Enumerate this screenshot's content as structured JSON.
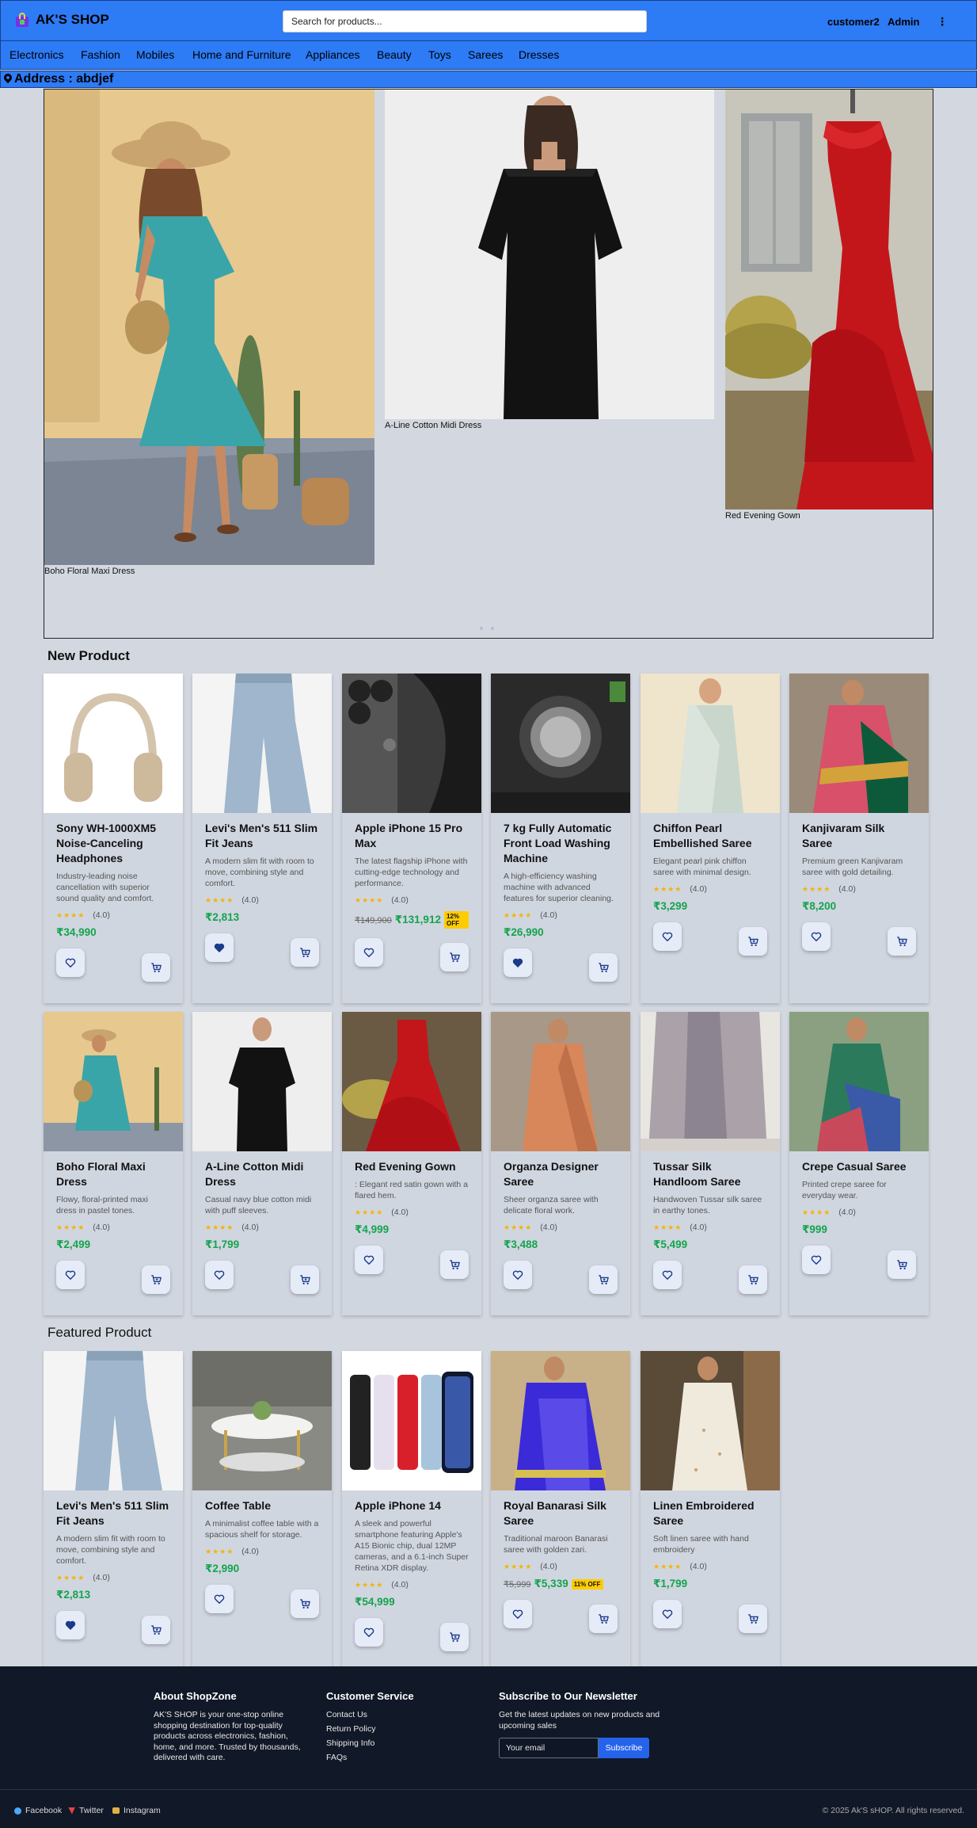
{
  "header": {
    "logo_text": "AK'S SHOP",
    "search_placeholder": "Search for products...",
    "user": "customer2",
    "admin": "Admin",
    "menu_icon": "⋮"
  },
  "categories": [
    "Electronics",
    "Fashion",
    "Mobiles",
    "Home and Furniture",
    "Appliances",
    "Beauty",
    "Toys",
    "Sarees",
    "Dresses"
  ],
  "address": "Address : abdjef",
  "carousel": {
    "slides": [
      {
        "caption": "Boho Floral Maxi Dress"
      },
      {
        "caption": "A-Line Cotton Midi Dress"
      },
      {
        "caption": "Red Evening Gown"
      }
    ]
  },
  "sections": {
    "new_product": "New Product",
    "featured_product": "Featured Product"
  },
  "new_products_row1": [
    {
      "title": "Sony WH-1000XM5 Noise-Canceling Headphones",
      "desc": "Industry-leading noise cancellation with superior sound quality and comfort.",
      "rating": "(4.0)",
      "price": "₹34,990",
      "old_price": "",
      "off": "",
      "wish_filled": false
    },
    {
      "title": "Levi's Men's 511 Slim Fit Jeans",
      "desc": "A modern slim fit with room to move, combining style and comfort.",
      "rating": "(4.0)",
      "price": "₹2,813",
      "old_price": "",
      "off": "",
      "wish_filled": true
    },
    {
      "title": "Apple iPhone 15 Pro Max",
      "desc": "The latest flagship iPhone with cutting-edge technology and performance.",
      "rating": "(4.0)",
      "price": "₹131,912",
      "old_price": "₹149,900",
      "off": "12% OFF",
      "wish_filled": false
    },
    {
      "title": "7 kg Fully Automatic Front Load Washing Machine",
      "desc": "A high-efficiency washing machine with advanced features for superior cleaning.",
      "rating": "(4.0)",
      "price": "₹26,990",
      "old_price": "",
      "off": "",
      "wish_filled": true
    },
    {
      "title": "Chiffon Pearl Embellished Saree",
      "desc": "Elegant pearl pink chiffon saree with minimal design.",
      "rating": "(4.0)",
      "price": "₹3,299",
      "old_price": "",
      "off": "",
      "wish_filled": false
    },
    {
      "title": "Kanjivaram Silk Saree",
      "desc": "Premium green Kanjivaram saree with gold detailing.",
      "rating": "(4.0)",
      "price": "₹8,200",
      "old_price": "",
      "off": "",
      "wish_filled": false
    }
  ],
  "new_products_row2": [
    {
      "title": "Boho Floral Maxi Dress",
      "desc": "Flowy, floral-printed maxi dress in pastel tones.",
      "rating": "(4.0)",
      "price": "₹2,499",
      "old_price": "",
      "off": "",
      "wish_filled": false
    },
    {
      "title": "A-Line Cotton Midi Dress",
      "desc": "Casual navy blue cotton midi with puff sleeves.",
      "rating": "(4.0)",
      "price": "₹1,799",
      "old_price": "",
      "off": "",
      "wish_filled": false
    },
    {
      "title": "Red Evening Gown",
      "desc": ": Elegant red satin gown with a flared hem.",
      "rating": "(4.0)",
      "price": "₹4,999",
      "old_price": "",
      "off": "",
      "wish_filled": false
    },
    {
      "title": "Organza Designer Saree",
      "desc": "Sheer organza saree with delicate floral work.",
      "rating": "(4.0)",
      "price": "₹3,488",
      "old_price": "",
      "off": "",
      "wish_filled": false
    },
    {
      "title": "Tussar Silk Handloom Saree",
      "desc": "Handwoven Tussar silk saree in earthy tones.",
      "rating": "(4.0)",
      "price": "₹5,499",
      "old_price": "",
      "off": "",
      "wish_filled": false
    },
    {
      "title": "Crepe Casual Saree",
      "desc": "Printed crepe saree for everyday wear.",
      "rating": "(4.0)",
      "price": "₹999",
      "old_price": "",
      "off": "",
      "wish_filled": false
    }
  ],
  "featured_products": [
    {
      "title": "Levi's Men's 511 Slim Fit Jeans",
      "desc": "A modern slim fit with room to move, combining style and comfort.",
      "rating": "(4.0)",
      "price": "₹2,813",
      "old_price": "",
      "off": "",
      "wish_filled": true
    },
    {
      "title": "Coffee Table",
      "desc": "A minimalist coffee table with a spacious shelf for storage.",
      "rating": "(4.0)",
      "price": "₹2,990",
      "old_price": "",
      "off": "",
      "wish_filled": false
    },
    {
      "title": "Apple iPhone 14",
      "desc": "A sleek and powerful smartphone featuring Apple's A15 Bionic chip, dual 12MP cameras, and a 6.1-inch Super Retina XDR display.",
      "rating": "(4.0)",
      "price": "₹54,999",
      "old_price": "",
      "off": "",
      "wish_filled": false
    },
    {
      "title": "Royal Banarasi Silk Saree",
      "desc": "Traditional maroon Banarasi saree with golden zari.",
      "rating": "(4.0)",
      "price": "₹5,339",
      "old_price": "₹5,999",
      "off": "11% OFF",
      "wish_filled": false
    },
    {
      "title": "Linen Embroidered Saree",
      "desc": "Soft linen saree with hand embroidery",
      "rating": "(4.0)",
      "price": "₹1,799",
      "old_price": "",
      "off": "",
      "wish_filled": false
    }
  ],
  "stars": "★★★★",
  "footer": {
    "about_title": "About ShopZone",
    "about_text": "AK'S SHOP is your one-stop online shopping destination for top-quality products across electronics, fashion, home, and more. Trusted by thousands, delivered with care.",
    "service_title": "Customer Service",
    "service_links": [
      "Contact Us",
      "Return Policy",
      "Shipping Info",
      "FAQs"
    ],
    "newsletter_title": "Subscribe to Our Newsletter",
    "newsletter_text": "Get the latest updates on new products and upcoming sales",
    "email_placeholder": "Your email",
    "subscribe_label": "Subscribe",
    "social": [
      "Facebook",
      "Twitter",
      "Instagram"
    ],
    "copyright": "© 2025 Ak'S sHOP. All rights reserved."
  },
  "colors": {
    "header_blue": "#2d7bf5",
    "price_green": "#14a44d",
    "footer_bg": "#111827",
    "subscribe_blue": "#2563eb"
  }
}
